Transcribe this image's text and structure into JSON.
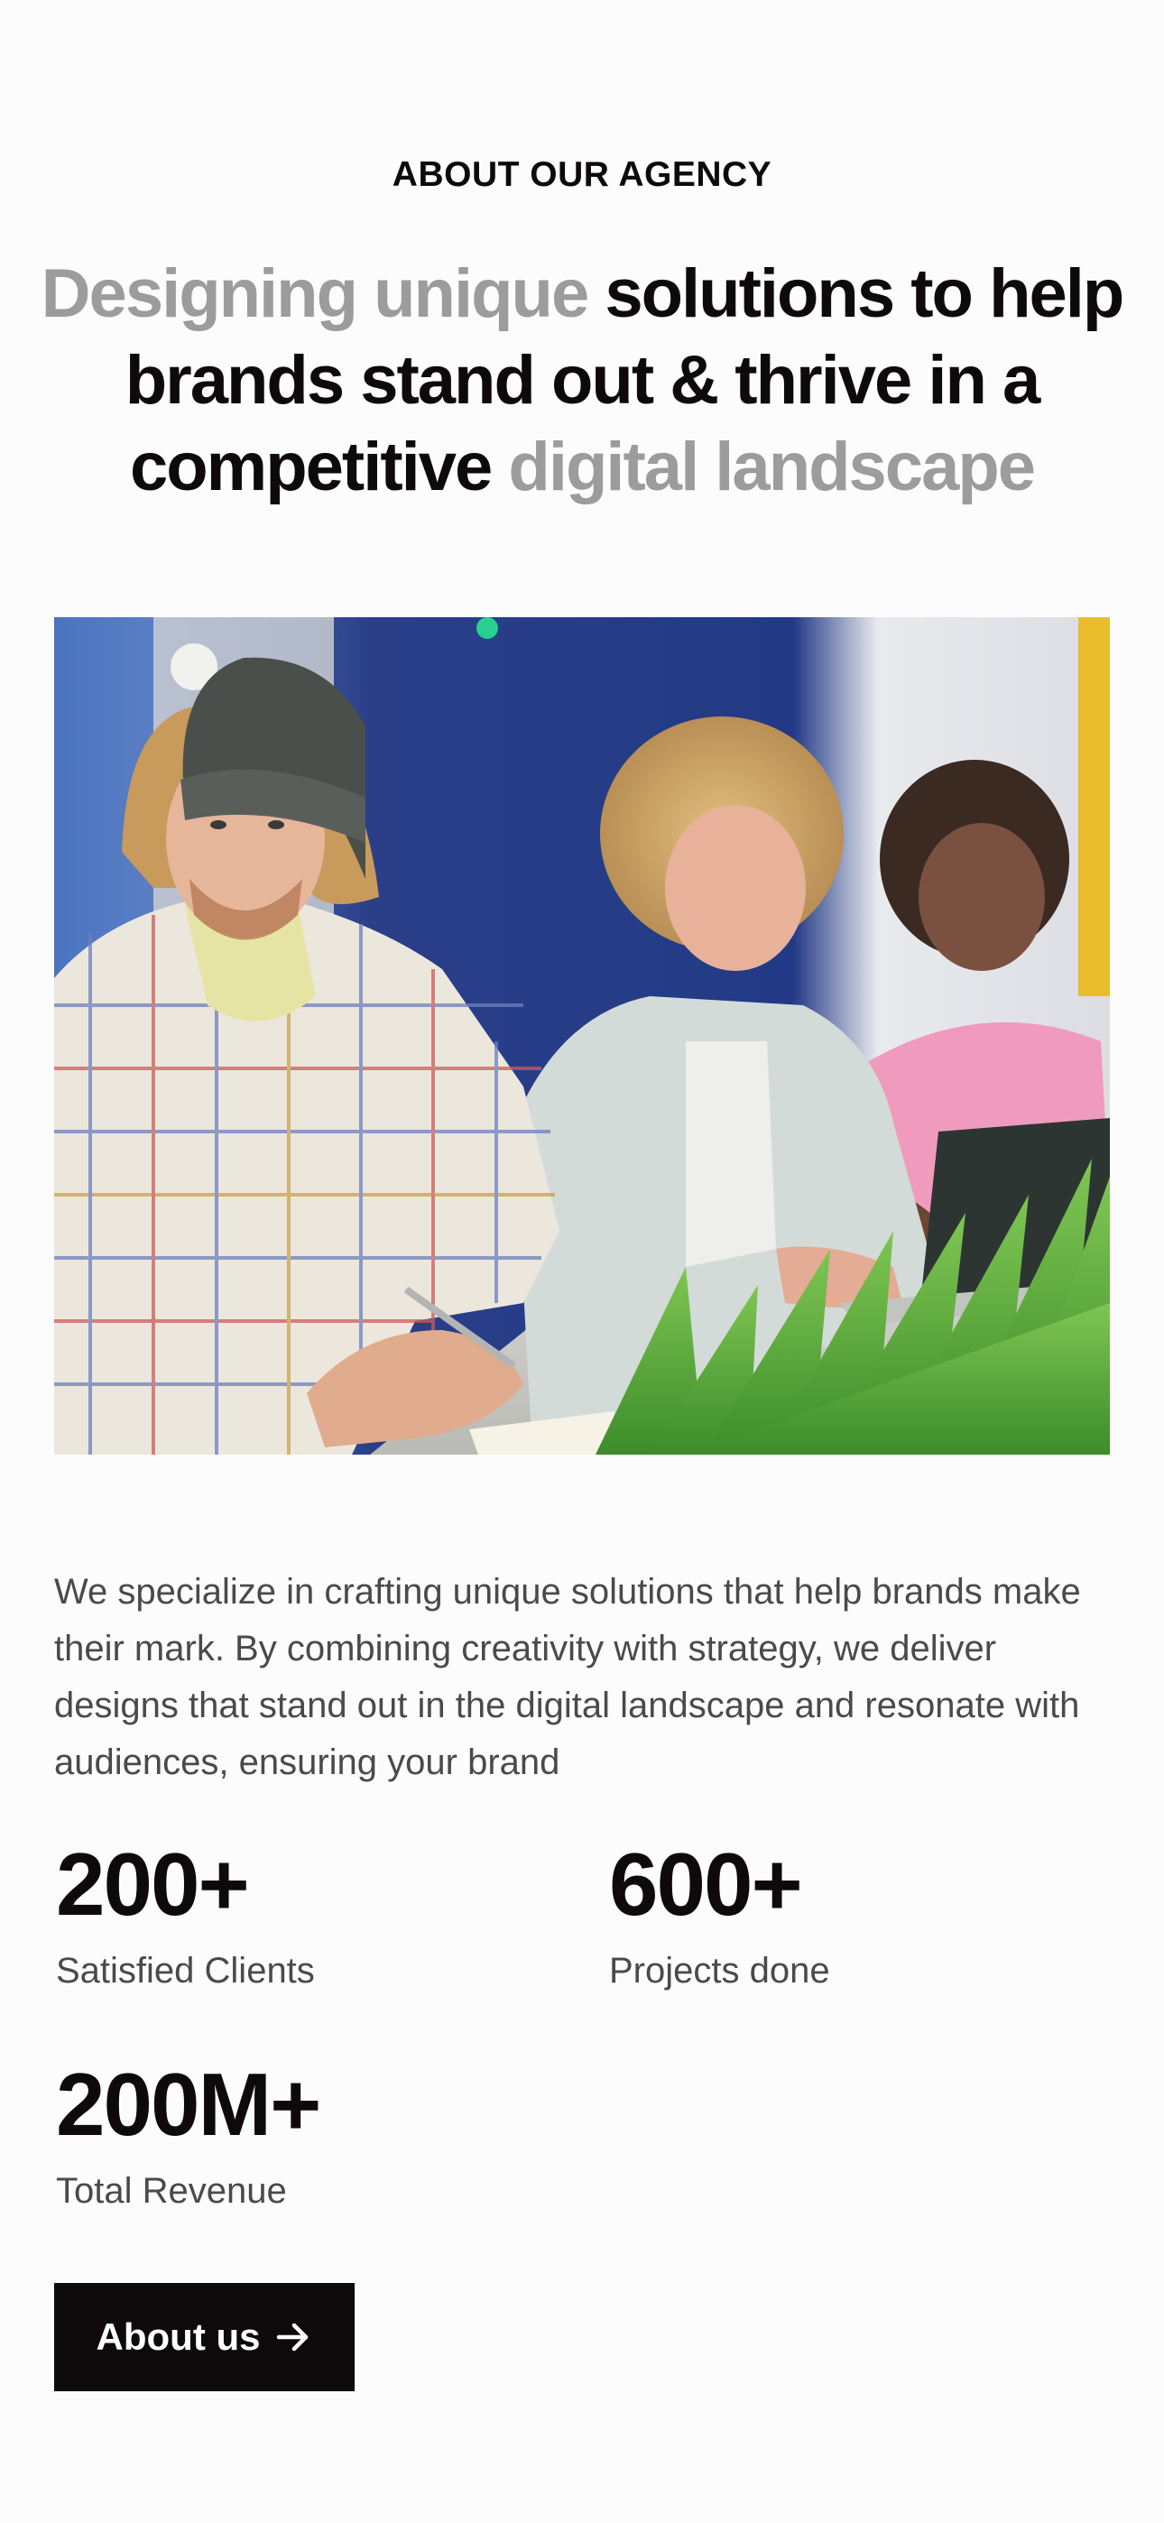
{
  "section": {
    "eyebrow": "ABOUT OUR  AGENCY",
    "headline": {
      "muted_start": "Designing unique",
      "dark": "solutions to help brands stand out & thrive in a competitive",
      "muted_end": "digital landscape"
    },
    "description": "We specialize in crafting unique solutions that help brands make their mark. By combining creativity with strategy, we deliver designs that stand out in the digital landscape and resonate with audiences, ensuring your brand"
  },
  "stats": [
    {
      "value": "200+",
      "label": "Satisfied Clients"
    },
    {
      "value": "600+",
      "label": "Projects done"
    },
    {
      "value": "200M+",
      "label": "Total Revenue"
    }
  ],
  "cta": {
    "label": "About us",
    "icon": "arrow-right-icon"
  },
  "colors": {
    "text_dark": "#0e0a0c",
    "text_muted": "#9c9c9c",
    "body_text": "#4a4a4c",
    "button_bg": "#0e0a0c",
    "button_text": "#ffffff"
  }
}
